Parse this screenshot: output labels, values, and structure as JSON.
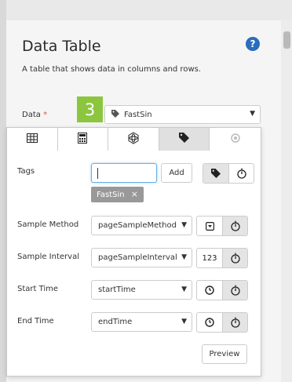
{
  "panel": {
    "title": "Data Table",
    "description": "A table that shows data in columns and rows."
  },
  "data_field": {
    "label": "Data",
    "required_mark": "*",
    "step_number": "3",
    "selected_value": "FastSin"
  },
  "tabs": [
    {
      "icon": "table-icon",
      "active": false
    },
    {
      "icon": "calculator-icon",
      "active": false
    },
    {
      "icon": "atom-icon",
      "active": false
    },
    {
      "icon": "tag-icon",
      "active": true
    },
    {
      "icon": "circle-icon",
      "active": false,
      "disabled": true
    }
  ],
  "tags": {
    "label": "Tags",
    "input_value": "",
    "add_label": "Add",
    "chip_text": "FastSin",
    "chip_remove": "×"
  },
  "sample_method": {
    "label": "Sample Method",
    "value": "pageSampleMethod"
  },
  "sample_interval": {
    "label": "Sample Interval",
    "value": "pageSampleInterval",
    "number_label": "123"
  },
  "start_time": {
    "label": "Start Time",
    "value": "startTime"
  },
  "end_time": {
    "label": "End Time",
    "value": "endTime"
  },
  "preview_label": "Preview",
  "colors": {
    "step_badge": "#8cc63f",
    "help_icon": "#2a6ebb",
    "required": "#d9534f",
    "chip": "#999999"
  }
}
